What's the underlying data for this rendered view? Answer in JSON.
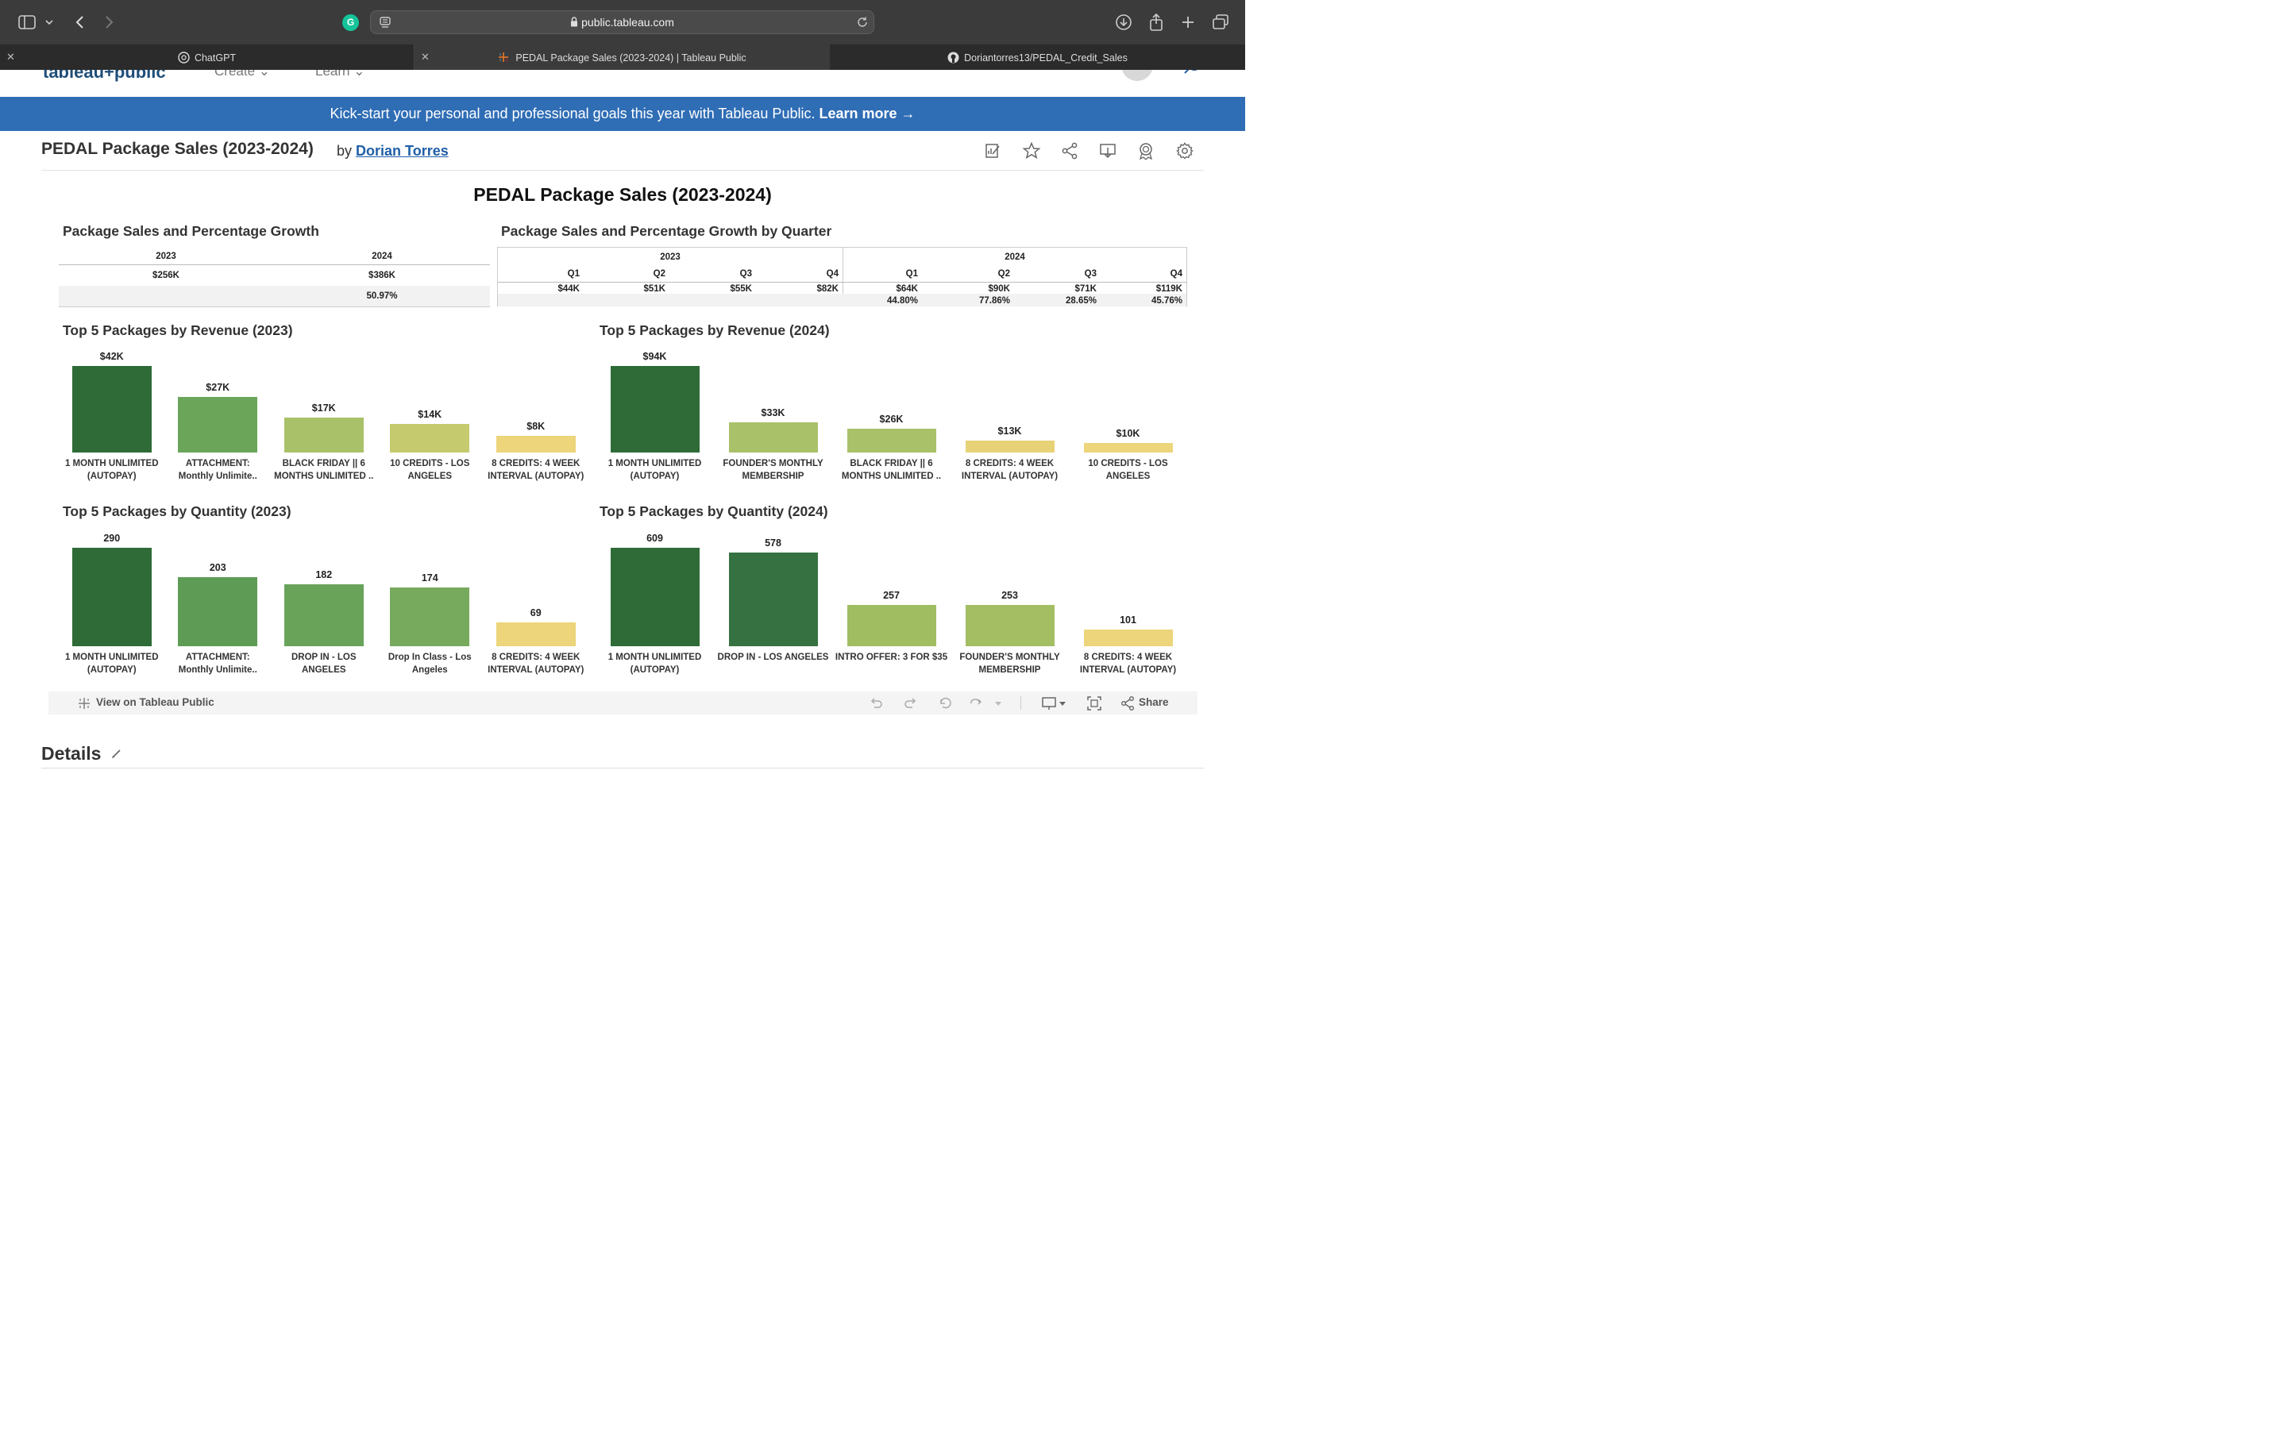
{
  "browser": {
    "url": "public.tableau.com",
    "tabs": [
      {
        "title": "ChatGPT",
        "active": false
      },
      {
        "title": "PEDAL Package Sales (2023-2024) | Tableau Public",
        "active": true
      },
      {
        "title": "Doriantorres13/PEDAL_Credit_Sales",
        "active": false
      }
    ]
  },
  "site_nav": {
    "create": "Create",
    "learn": "Learn"
  },
  "banner": {
    "text": "Kick-start your personal and professional goals this year with Tableau Public.",
    "link": "Learn more →"
  },
  "viz": {
    "title": "PEDAL Package Sales (2023-2024)",
    "by": "by",
    "author": "Dorian Torres"
  },
  "dashboard": {
    "title": "PEDAL Package Sales (2023-2024)",
    "growth_title": "Package Sales and Percentage Growth",
    "growth_q_title": "Package Sales and Percentage Growth by Quarter",
    "yearly": {
      "years": [
        "2023",
        "2024"
      ],
      "sales": [
        "$256K",
        "$386K"
      ],
      "growth": "50.97%"
    },
    "quarterly": {
      "years": [
        "2023",
        "2024"
      ],
      "quarters": [
        "Q1",
        "Q2",
        "Q3",
        "Q4",
        "Q1",
        "Q2",
        "Q3",
        "Q4"
      ],
      "sales": [
        "$44K",
        "$51K",
        "$55K",
        "$82K",
        "$64K",
        "$90K",
        "$71K",
        "$119K"
      ],
      "growth": [
        "",
        "",
        "",
        "",
        "44.80%",
        "77.86%",
        "28.65%",
        "45.76%"
      ]
    }
  },
  "chart_data": [
    {
      "type": "bar",
      "title": "Top 5 Packages by Revenue (2023)",
      "categories": [
        "1 MONTH UNLIMITED\n(AUTOPAY)",
        "ATTACHMENT:\nMonthly Unlimite..",
        "BLACK FRIDAY || 6\nMONTHS UNLIMITED ..",
        "10 CREDITS - LOS\nANGELES",
        "8 CREDITS: 4 WEEK\nINTERVAL (AUTOPAY)"
      ],
      "values": [
        42,
        27,
        17,
        14,
        8
      ],
      "labels": [
        "$42K",
        "$27K",
        "$17K",
        "$14K",
        "$8K"
      ],
      "colors": [
        "#2e6b37",
        "#6aa55a",
        "#a9c168",
        "#c5ca6e",
        "#ecd57a"
      ]
    },
    {
      "type": "bar",
      "title": "Top 5 Packages by Revenue (2024)",
      "categories": [
        "1 MONTH UNLIMITED\n(AUTOPAY)",
        "FOUNDER'S MONTHLY\nMEMBERSHIP",
        "BLACK FRIDAY || 6\nMONTHS UNLIMITED ..",
        "8 CREDITS: 4 WEEK\nINTERVAL (AUTOPAY)",
        "10 CREDITS - LOS\nANGELES"
      ],
      "values": [
        94,
        33,
        26,
        13,
        10
      ],
      "labels": [
        "$94K",
        "$33K",
        "$26K",
        "$13K",
        "$10K"
      ],
      "colors": [
        "#2e6b37",
        "#a9c168",
        "#a9c168",
        "#e7d277",
        "#ecd57a"
      ]
    },
    {
      "type": "bar",
      "title": "Top 5 Packages by Quantity (2023)",
      "categories": [
        "1 MONTH UNLIMITED\n(AUTOPAY)",
        "ATTACHMENT:\nMonthly Unlimite..",
        "DROP IN - LOS\nANGELES",
        "Drop In Class - Los\nAngeles",
        "8 CREDITS: 4 WEEK\nINTERVAL (AUTOPAY)"
      ],
      "values": [
        290,
        203,
        182,
        174,
        69
      ],
      "labels": [
        "290",
        "203",
        "182",
        "174",
        "69"
      ],
      "colors": [
        "#2e6b37",
        "#5e9c55",
        "#68a359",
        "#78aa5e",
        "#ecd57a"
      ]
    },
    {
      "type": "bar",
      "title": "Top 5 Packages by Quantity (2024)",
      "categories": [
        "1 MONTH UNLIMITED\n(AUTOPAY)",
        "DROP IN - LOS ANGELES",
        "INTRO OFFER: 3 FOR $35",
        "FOUNDER'S MONTHLY\nMEMBERSHIP",
        "8 CREDITS: 4 WEEK\nINTERVAL (AUTOPAY)"
      ],
      "values": [
        609,
        578,
        257,
        253,
        101
      ],
      "labels": [
        "609",
        "578",
        "257",
        "253",
        "101"
      ],
      "colors": [
        "#2e6b37",
        "#367241",
        "#a0bd62",
        "#a3be63",
        "#ecd57a"
      ]
    }
  ],
  "viz_toolbar": {
    "view_on": "View on Tableau Public",
    "share": "Share"
  },
  "details": {
    "title": "Details"
  }
}
